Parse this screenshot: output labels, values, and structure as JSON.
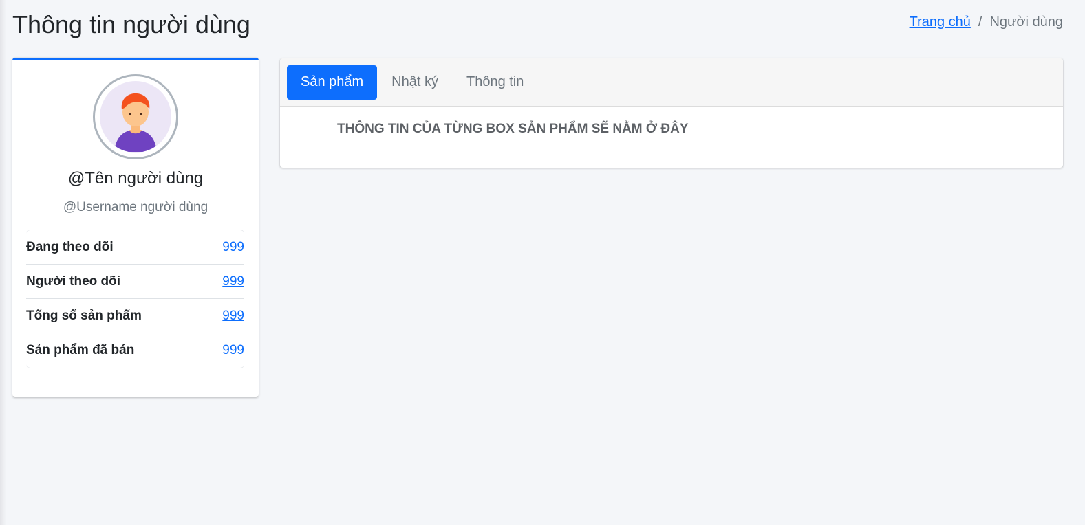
{
  "page": {
    "title": "Thông tin người dùng"
  },
  "breadcrumb": {
    "home": "Trang chủ",
    "separator": "/",
    "current": "Người dùng"
  },
  "profile": {
    "avatar_icon": "user-avatar-icon",
    "name": "@Tên người dùng",
    "username": "@Username người dùng",
    "stats": [
      {
        "label": "Đang theo dõi",
        "value": "999"
      },
      {
        "label": "Người theo dõi",
        "value": "999"
      },
      {
        "label": "Tổng số sản phẩm",
        "value": "999"
      },
      {
        "label": "Sản phẩm đã bán",
        "value": "999"
      }
    ]
  },
  "tabs": [
    {
      "label": "Sản phẩm",
      "active": true
    },
    {
      "label": "Nhật ký",
      "active": false
    },
    {
      "label": "Thông tin",
      "active": false
    }
  ],
  "tab_content": {
    "text": "THÔNG TIN CỦA TỪNG BOX SẢN PHẨM SẼ NẰM Ở ĐÂY"
  },
  "colors": {
    "accent": "#0d6efd",
    "background": "#f4f6f9",
    "muted_text": "#6c757d"
  }
}
